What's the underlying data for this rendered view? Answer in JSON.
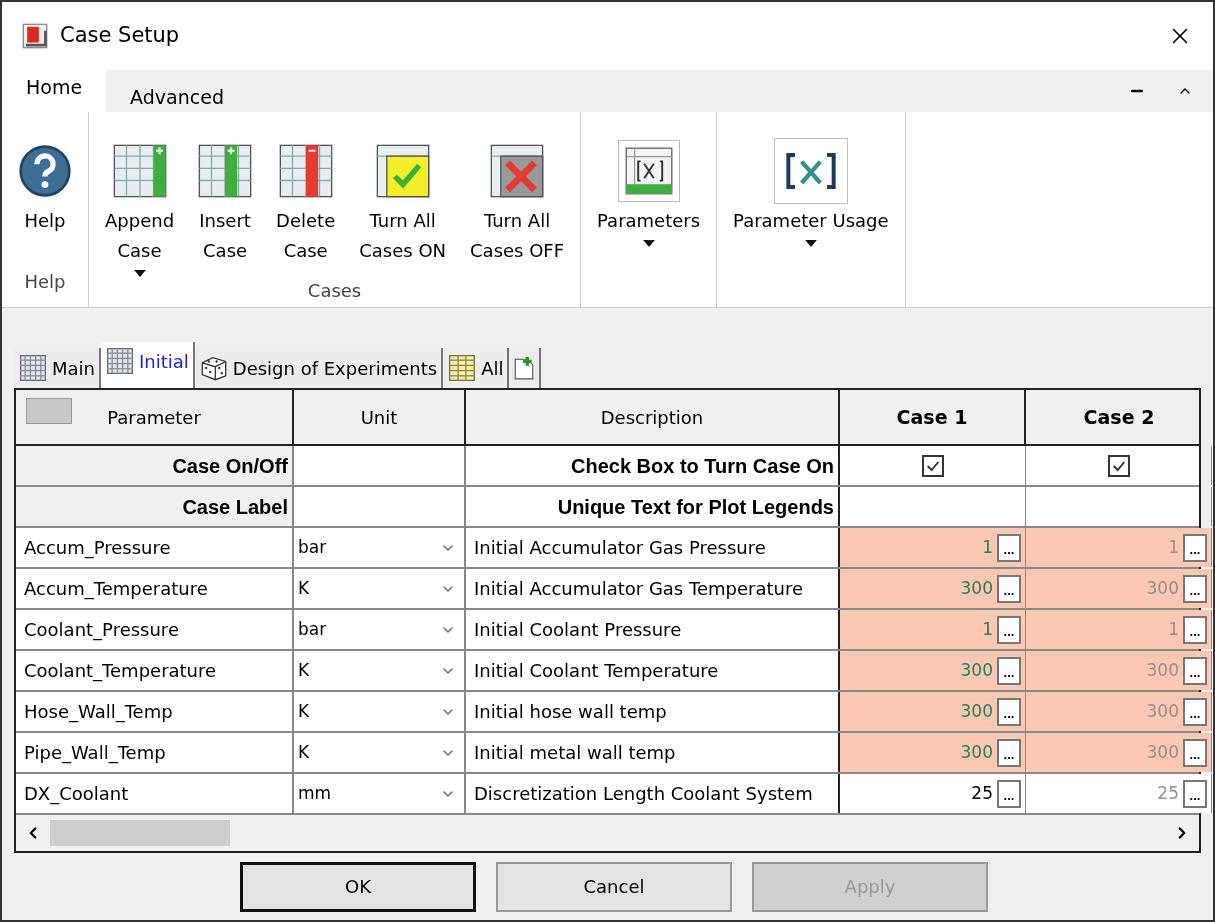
{
  "window": {
    "title": "Case Setup"
  },
  "ribbon_tabs": [
    {
      "label": "Home",
      "selected": true
    },
    {
      "label": "Advanced",
      "selected": false
    }
  ],
  "ribbon_groups": [
    {
      "label": "Help",
      "items": [
        {
          "kind": "help",
          "lines": [
            "Help"
          ],
          "dropdown": false
        }
      ]
    },
    {
      "label": "Cases",
      "items": [
        {
          "kind": "append",
          "lines": [
            "Append",
            "Case"
          ],
          "dropdown": true
        },
        {
          "kind": "insert",
          "lines": [
            "Insert",
            "Case"
          ],
          "dropdown": false
        },
        {
          "kind": "delete",
          "lines": [
            "Delete",
            "Case"
          ],
          "dropdown": false
        },
        {
          "kind": "all-on",
          "lines": [
            "Turn All",
            "Cases ON"
          ],
          "dropdown": false
        },
        {
          "kind": "all-off",
          "lines": [
            "Turn All",
            "Cases OFF"
          ],
          "dropdown": false
        }
      ]
    },
    {
      "items": [
        {
          "kind": "parameters",
          "lines": [
            "Parameters"
          ],
          "dropdown": true
        }
      ]
    },
    {
      "items": [
        {
          "kind": "usage",
          "lines": [
            "Parameter Usage"
          ],
          "dropdown": true
        }
      ]
    }
  ],
  "doc_tabs": [
    {
      "kind": "grid",
      "label": "Main",
      "selected": false
    },
    {
      "kind": "grid",
      "label": "Initial",
      "selected": true
    },
    {
      "kind": "dice",
      "label": "Design of Experiments",
      "selected": false
    },
    {
      "kind": "table",
      "label": "All",
      "selected": false
    },
    {
      "kind": "add",
      "selected": false
    }
  ],
  "table": {
    "columns": [
      "Parameter",
      "Unit",
      "Description",
      "Case 1",
      "Case 2"
    ],
    "special_rows": [
      {
        "kind": "checkbox",
        "label": "Case On/Off",
        "description": "Check Box to Turn Case On",
        "cases": [
          {
            "checked": true
          },
          {
            "checked": true
          }
        ]
      },
      {
        "kind": "text",
        "label": "Case Label",
        "description": "Unique Text for Plot Legends"
      }
    ],
    "rows": [
      {
        "parameter": "Accum_Pressure",
        "unit": "bar",
        "description": "Initial Accumulator Gas Pressure",
        "highlighted": true,
        "cells": [
          {
            "value": "1",
            "kind": "changed"
          },
          {
            "value": "1",
            "kind": "inherited"
          }
        ]
      },
      {
        "parameter": "Accum_Temperature",
        "unit": "K",
        "description": "Initial Accumulator Gas Temperature",
        "highlighted": true,
        "cells": [
          {
            "value": "300",
            "kind": "changed"
          },
          {
            "value": "300",
            "kind": "inherited"
          }
        ]
      },
      {
        "parameter": "Coolant_Pressure",
        "unit": "bar",
        "description": "Initial Coolant Pressure",
        "highlighted": true,
        "cells": [
          {
            "value": "1",
            "kind": "changed"
          },
          {
            "value": "1",
            "kind": "inherited"
          }
        ]
      },
      {
        "parameter": "Coolant_Temperature",
        "unit": "K",
        "description": "Initial Coolant Temperature",
        "highlighted": true,
        "cells": [
          {
            "value": "300",
            "kind": "changed"
          },
          {
            "value": "300",
            "kind": "inherited"
          }
        ]
      },
      {
        "parameter": "Hose_Wall_Temp",
        "unit": "K",
        "description": "Initial hose wall temp",
        "highlighted": true,
        "cells": [
          {
            "value": "300",
            "kind": "changed"
          },
          {
            "value": "300",
            "kind": "inherited"
          }
        ]
      },
      {
        "parameter": "Pipe_Wall_Temp",
        "unit": "K",
        "description": "Initial metal wall temp",
        "highlighted": true,
        "cells": [
          {
            "value": "300",
            "kind": "changed"
          },
          {
            "value": "300",
            "kind": "inherited"
          }
        ]
      },
      {
        "parameter": "DX_Coolant",
        "unit": "mm",
        "description": "Discretization Length Coolant System",
        "highlighted": false,
        "cells": [
          {
            "value": "25",
            "kind": "plain"
          },
          {
            "value": "25",
            "kind": "inherited"
          }
        ]
      }
    ],
    "cell_button": "..."
  },
  "buttons": [
    {
      "label": "OK",
      "focused": true,
      "disabled": false
    },
    {
      "label": "Cancel",
      "focused": false,
      "disabled": false
    },
    {
      "label": "Apply",
      "focused": false,
      "disabled": true
    }
  ]
}
